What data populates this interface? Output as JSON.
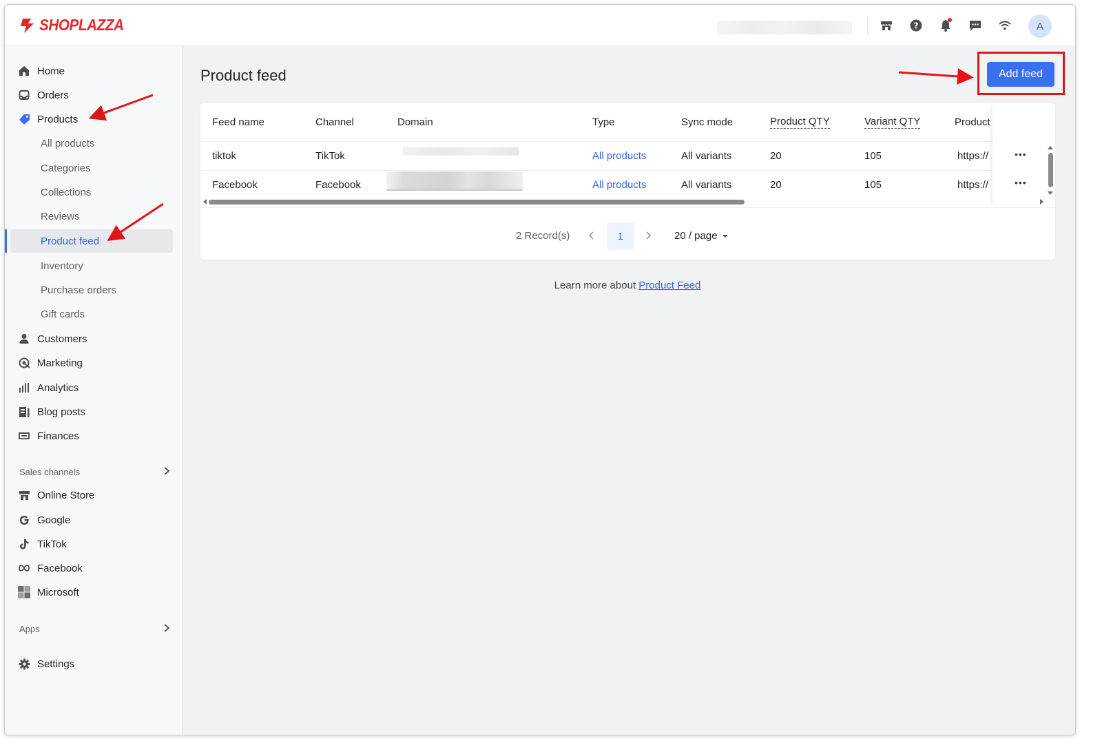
{
  "brand": {
    "name": "SHOPLAZZA",
    "color": "#e8262a"
  },
  "header": {
    "icons": [
      "store-icon",
      "help-icon",
      "bell-icon",
      "chat-icon",
      "wifi-icon"
    ],
    "avatar_letter": "A"
  },
  "sidebar": {
    "items": [
      {
        "label": "Home",
        "icon": "home-icon"
      },
      {
        "label": "Orders",
        "icon": "inbox-icon"
      },
      {
        "label": "Products",
        "icon": "tag-icon"
      },
      {
        "label": "Customers",
        "icon": "person-icon"
      },
      {
        "label": "Marketing",
        "icon": "target-icon"
      },
      {
        "label": "Analytics",
        "icon": "bar-chart-icon"
      },
      {
        "label": "Blog posts",
        "icon": "blog-icon"
      },
      {
        "label": "Finances",
        "icon": "wallet-icon"
      }
    ],
    "product_sub": [
      "All products",
      "Categories",
      "Collections",
      "Reviews",
      "Product feed",
      "Inventory",
      "Purchase orders",
      "Gift cards"
    ],
    "active_sub": "Product feed",
    "sales_channels_label": "Sales channels",
    "channels": [
      {
        "label": "Online Store",
        "icon": "store-icon"
      },
      {
        "label": "Google",
        "icon": "google-icon"
      },
      {
        "label": "TikTok",
        "icon": "tiktok-icon"
      },
      {
        "label": "Facebook",
        "icon": "meta-icon"
      },
      {
        "label": "Microsoft",
        "icon": "microsoft-icon"
      }
    ],
    "apps_label": "Apps",
    "settings_label": "Settings"
  },
  "main": {
    "title": "Product feed",
    "add_button": "Add feed",
    "table": {
      "columns": [
        "Feed name",
        "Channel",
        "Domain",
        "Type",
        "Sync mode",
        "Product QTY",
        "Variant QTY",
        "Product"
      ],
      "rows": [
        {
          "feed_name": "tiktok",
          "channel": "TikTok",
          "type": "All products",
          "sync_mode": "All variants",
          "product_qty": "20",
          "variant_qty": "105",
          "product": "https://"
        },
        {
          "feed_name": "Facebook",
          "channel": "Facebook",
          "type": "All products",
          "sync_mode": "All variants",
          "product_qty": "20",
          "variant_qty": "105",
          "product": "https://"
        }
      ]
    },
    "pagination": {
      "records": "2 Record(s)",
      "current_page": "1",
      "per_page": "20 / page"
    },
    "learn_more_prefix": "Learn more about",
    "learn_more_link": "Product Feed"
  },
  "colors": {
    "accent": "#3a6ff0",
    "annotation": "#e01515",
    "link": "#3562e6"
  }
}
